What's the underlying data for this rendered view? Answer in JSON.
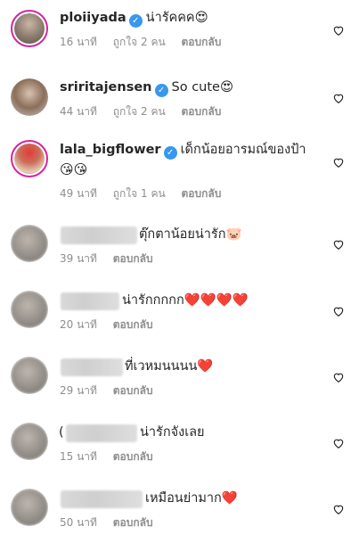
{
  "comments": [
    {
      "username": "ploiiyada",
      "text": "น่ารัคคค😍",
      "time": "16 นาที",
      "likes": "ถูกใจ 2 คน",
      "reply": "ตอบกลับ"
    },
    {
      "username": "sriritajensen",
      "text": "So cute😍",
      "time": "44 นาที",
      "likes": "ถูกใจ 2 คน",
      "reply": "ตอบกลับ"
    },
    {
      "username": "lala_bigflower",
      "text": "เด็กน้อยอารมณ์ของป้า",
      "text2": "😘😘",
      "time": "49 นาที",
      "likes": "ถูกใจ 1 คน",
      "reply": "ตอบกลับ"
    },
    {
      "text": "ตุ๊กตาน้อยน่ารัก🐷",
      "time": "39 นาที",
      "reply": "ตอบกลับ"
    },
    {
      "text": "น่ารักกกกก❤️❤️❤️❤️",
      "time": "20 นาที",
      "reply": "ตอบกลับ"
    },
    {
      "text": "ที่เวหมนนนน❤️",
      "time": "29 นาที",
      "reply": "ตอบกลับ"
    },
    {
      "prefix": "(",
      "text": "น่ารักจังเลย",
      "time": "15 นาที",
      "reply": "ตอบกลับ"
    },
    {
      "text": "เหมือนย่ามาก❤️",
      "time": "50 นาที",
      "reply": "ตอบกลับ"
    }
  ],
  "colors": {
    "verified": "#3897f0",
    "meta": "#8e8e8e",
    "text": "#262626"
  }
}
